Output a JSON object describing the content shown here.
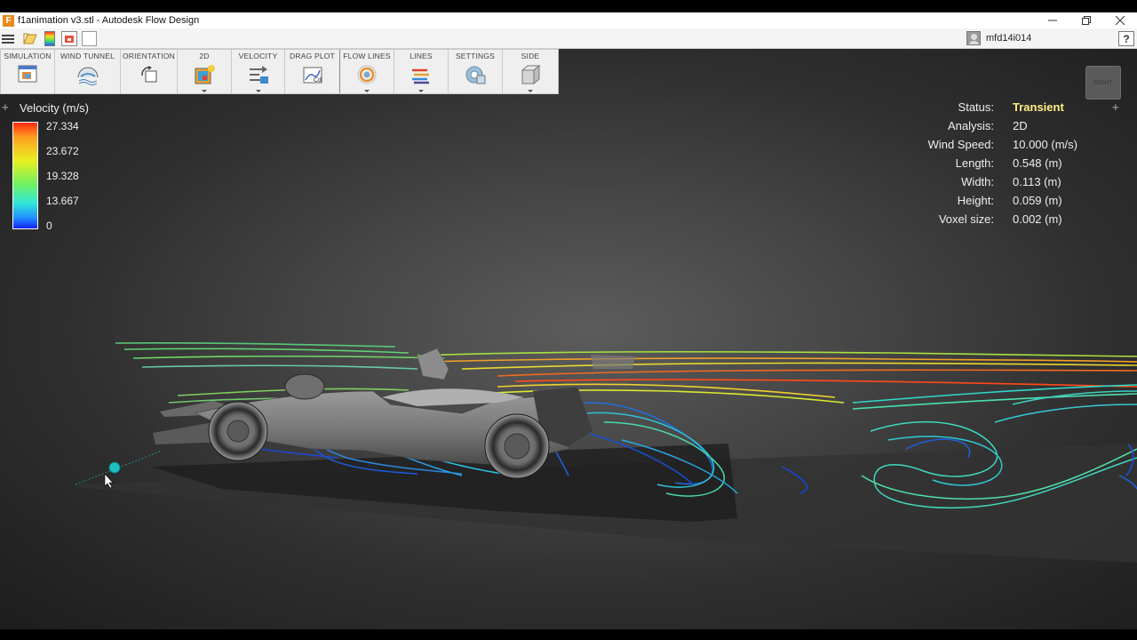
{
  "window": {
    "title": "f1animation v3.stl - Autodesk Flow Design",
    "controls": [
      "minimize-icon",
      "restore-icon",
      "close-icon"
    ]
  },
  "quickbar": {
    "username": "mfd14i014",
    "help": "?"
  },
  "ribbon": {
    "groups": [
      {
        "label": "SIMULATION",
        "icon": "simulation-icon"
      },
      {
        "label": "WIND TUNNEL",
        "icon": "wind-tunnel-icon"
      },
      {
        "label": "ORIENTATION",
        "icon": "orientation-icon"
      },
      {
        "label": "2D",
        "icon": "2d-icon"
      },
      {
        "label": "VELOCITY",
        "icon": "velocity-icon"
      },
      {
        "label": "DRAG PLOT",
        "icon": "drag-plot-icon"
      },
      {
        "label": "FLOW LINES",
        "icon": "flow-lines-icon"
      },
      {
        "label": "LINES",
        "icon": "lines-icon"
      },
      {
        "label": "SETTINGS",
        "icon": "settings-icon"
      },
      {
        "label": "SIDE",
        "icon": "side-view-icon"
      }
    ]
  },
  "legend": {
    "title": "Velocity (m/s)",
    "ticks": [
      "27.334",
      "23.672",
      "19.328",
      "13.667",
      "0"
    ],
    "colors": [
      "#ff2a10",
      "#ffa020",
      "#e8f020",
      "#70f060",
      "#30e8d8",
      "#2090ff",
      "#1520ff"
    ]
  },
  "stats": {
    "status": {
      "label": "Status:",
      "value": "Transient"
    },
    "analysis": {
      "label": "Analysis:",
      "value": "2D"
    },
    "wind_speed": {
      "label": "Wind Speed:",
      "value": "10.000 (m/s)"
    },
    "length": {
      "label": "Length:",
      "value": "0.548 (m)"
    },
    "width": {
      "label": "Width:",
      "value": "0.113 (m)"
    },
    "height": {
      "label": "Height:",
      "value": "0.059 (m)"
    },
    "voxel_size": {
      "label": "Voxel size:",
      "value": "0.002 (m)"
    }
  },
  "viewcube": {
    "face": "RIGHT"
  }
}
